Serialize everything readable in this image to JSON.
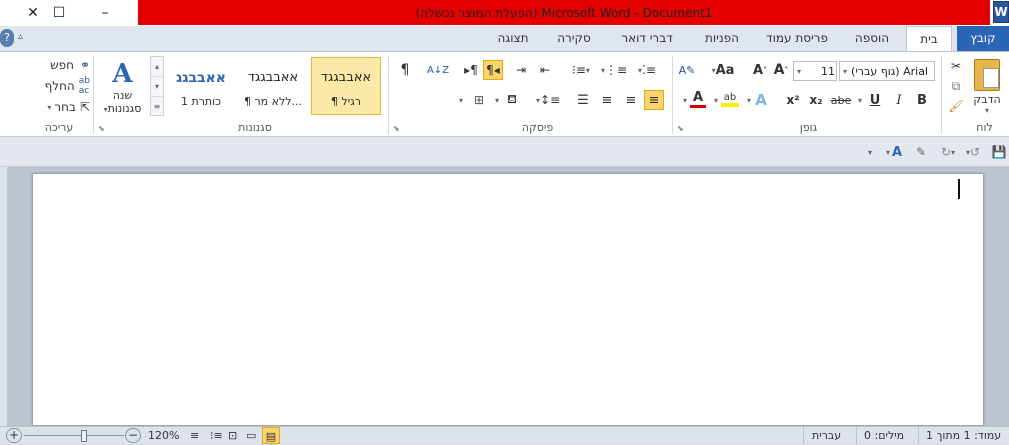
{
  "window": {
    "title": "(הפעלת המוצר נכשלה) Microsoft Word - Document1",
    "minimize": "–",
    "maximize": "☐",
    "close": "✕",
    "logo": "W"
  },
  "tabs": {
    "file": "קובץ",
    "home": "בית",
    "insert": "הוספה",
    "page_layout": "פריסת עמוד",
    "references": "הפניות",
    "mailings": "דברי דואר",
    "review": "סקירה",
    "view": "תצוגה"
  },
  "ribbon": {
    "clipboard": {
      "label": "לוח",
      "paste": "הדבק"
    },
    "font": {
      "label": "גופן",
      "font_name": "(גוף עברי) Arial",
      "font_size": "11",
      "bold": "B",
      "italic": "I",
      "underline": "U",
      "strike": "abe",
      "subscript": "x₂",
      "superscript": "x²",
      "grow": "A",
      "shrink": "A",
      "change_case": "Aa",
      "font_color": "A",
      "highlight": "ab",
      "text_effect": "A"
    },
    "paragraph": {
      "label": "פיסקה",
      "show_marks": "¶"
    },
    "styles": {
      "label": "סגנונות",
      "items": [
        {
          "sample": "אאבבגגד",
          "name": "¶ רגיל"
        },
        {
          "sample": "אאבבגגד",
          "name": "¶ ללא מר..."
        },
        {
          "sample": "אאבבגג",
          "name": "כותרת 1"
        }
      ],
      "change_styles": "שנה",
      "change_styles_2": "סגנונות"
    },
    "editing": {
      "label": "עריכה",
      "find": "חפש",
      "replace": "החלף",
      "select": "בחר"
    }
  },
  "status": {
    "page": "עמוד: 1 מתוך 1",
    "words": "מילים: 0",
    "language": "עברית",
    "zoom": "120%",
    "zoom_level": 0.6
  },
  "colors": {
    "title_bar": "#e50000",
    "file_tab": "#2b65b5",
    "font_color_red": "#d00000",
    "highlight_yellow": "#ffee00",
    "active_btn": "#fcd46c"
  }
}
